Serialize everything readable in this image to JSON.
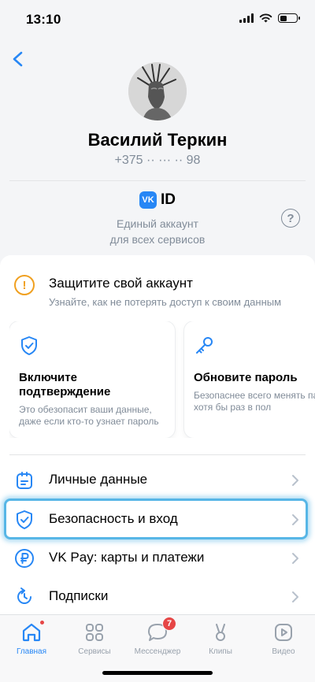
{
  "status_bar": {
    "time": "13:10"
  },
  "profile": {
    "name": "Василий Теркин",
    "phone": "+375 ·· ··· ·· 98"
  },
  "vkid": {
    "logo": "VK",
    "label": "ID",
    "description_line1": "Единый аккаунт",
    "description_line2": "для всех сервисов",
    "help": "?"
  },
  "alert": {
    "title": "Защитите свой аккаунт",
    "subtitle": "Узнайте, как не потерять доступ к своим данным",
    "icon": "!"
  },
  "tiles": [
    {
      "title": "Включите подтверждение",
      "subtitle": "Это обезопасит ваши данные, даже если кто-то узнает пароль",
      "icon": "shield-check-icon"
    },
    {
      "title": "Обновите пароль",
      "subtitle": "Безопаснее всего менять пароль хотя бы раз в пол",
      "icon": "key-icon"
    }
  ],
  "menu": [
    {
      "label": "Личные данные",
      "icon": "badge-icon"
    },
    {
      "label": "Безопасность и вход",
      "icon": "shield-icon"
    },
    {
      "label": "VK Pay: карты и платежи",
      "icon": "ruble-icon"
    },
    {
      "label": "Подписки",
      "icon": "refresh-icon"
    }
  ],
  "tabbar": [
    {
      "label": "Главная",
      "icon": "home-icon",
      "active": true,
      "dot": true
    },
    {
      "label": "Сервисы",
      "icon": "grid-icon"
    },
    {
      "label": "Мессенджер",
      "icon": "chat-icon",
      "badge": "7"
    },
    {
      "label": "Клипы",
      "icon": "clips-icon"
    },
    {
      "label": "Видео",
      "icon": "video-icon"
    }
  ],
  "colors": {
    "accent": "#2787f5",
    "secondary": "#818c99",
    "warning": "#f0a020",
    "highlight": "#57b6e6",
    "badge": "#e64646"
  }
}
